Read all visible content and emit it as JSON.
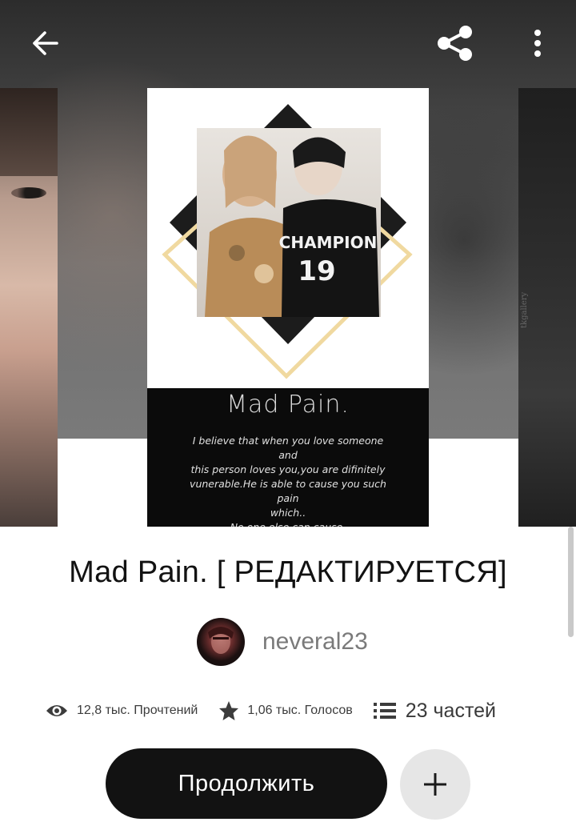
{
  "header": {
    "back_icon": "arrow-left-icon",
    "share_icon": "share-icon",
    "more_icon": "more-vertical-icon"
  },
  "cover": {
    "title": "Mad Pain.",
    "blurb": [
      "I believe that when you love someone",
      "and",
      "this person loves you,you are difinitely",
      "vunerable.He is able to cause you such",
      "pain",
      "which..",
      "No one else can cause."
    ],
    "jersey_text": "CHAMPION",
    "jersey_number": "19",
    "side_watermark": "tkgallery"
  },
  "story": {
    "title": "Mad Pain. [ РЕДАКТИРУЕТСЯ]",
    "author": "neveral23"
  },
  "stats": {
    "reads": "12,8 тыс. Прочтений",
    "votes": "1,06 тыс. Голосов",
    "parts": "23 частей"
  },
  "actions": {
    "continue_label": "Продолжить",
    "add_icon": "plus-icon"
  },
  "colors": {
    "primary_button": "#121212",
    "secondary_button": "#e6e6e6",
    "accent_gold": "#f0d9a0"
  }
}
